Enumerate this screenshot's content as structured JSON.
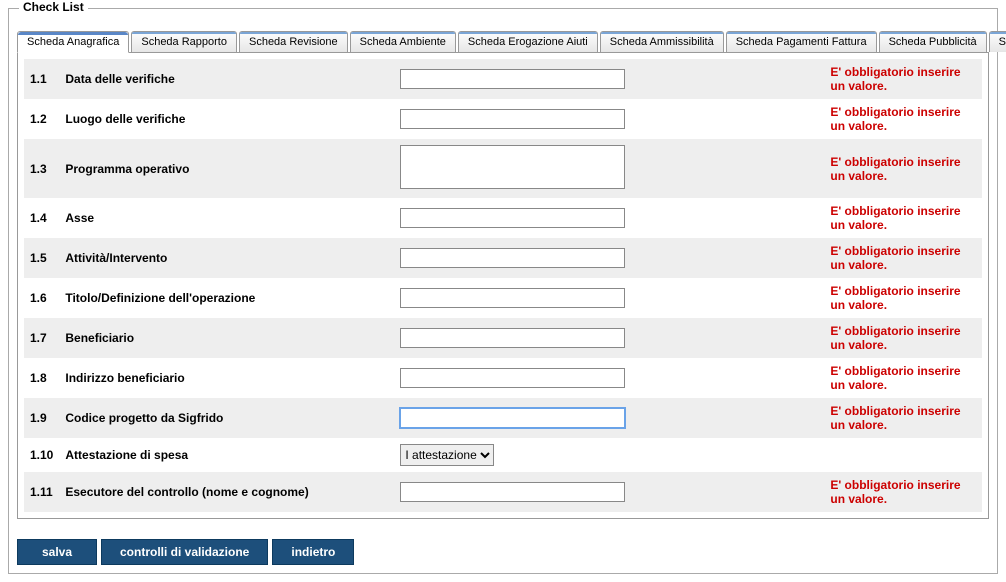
{
  "legend": "Check List",
  "tabs": [
    {
      "label": "Scheda Anagrafica",
      "active": true
    },
    {
      "label": "Scheda Rapporto",
      "active": false
    },
    {
      "label": "Scheda Revisione",
      "active": false
    },
    {
      "label": "Scheda Ambiente",
      "active": false
    },
    {
      "label": "Scheda Erogazione Aiuti",
      "active": false
    },
    {
      "label": "Scheda Ammissibilità",
      "active": false
    },
    {
      "label": "Scheda Pagamenti Fattura",
      "active": false
    },
    {
      "label": "Scheda Pubblicità",
      "active": false
    },
    {
      "label": "Scheda Generale",
      "active": false
    }
  ],
  "rows": [
    {
      "num": "1.1",
      "label": "Data delle verifiche",
      "type": "text",
      "value": "",
      "error": "E' obbligatorio inserire un valore."
    },
    {
      "num": "1.2",
      "label": "Luogo delle verifiche",
      "type": "text",
      "value": "",
      "error": "E' obbligatorio inserire un valore."
    },
    {
      "num": "1.3",
      "label": "Programma operativo",
      "type": "listbox",
      "value": "",
      "error": "E' obbligatorio inserire un valore."
    },
    {
      "num": "1.4",
      "label": "Asse",
      "type": "text",
      "value": "",
      "error": "E' obbligatorio inserire un valore."
    },
    {
      "num": "1.5",
      "label": "Attività/Intervento",
      "type": "text",
      "value": "",
      "error": "E' obbligatorio inserire un valore."
    },
    {
      "num": "1.6",
      "label": "Titolo/Definizione dell'operazione",
      "type": "text",
      "value": "",
      "error": "E' obbligatorio inserire un valore."
    },
    {
      "num": "1.7",
      "label": "Beneficiario",
      "type": "text",
      "value": "",
      "error": "E' obbligatorio inserire un valore."
    },
    {
      "num": "1.8",
      "label": "Indirizzo beneficiario",
      "type": "text",
      "value": "",
      "error": "E' obbligatorio inserire un valore."
    },
    {
      "num": "1.9",
      "label": "Codice progetto da Sigfrido",
      "type": "text",
      "value": "",
      "error": "E' obbligatorio inserire un valore.",
      "focused": true
    },
    {
      "num": "1.10",
      "label": "Attestazione di spesa",
      "type": "select",
      "value": "I attestazione",
      "options": [
        "I attestazione"
      ],
      "error": ""
    },
    {
      "num": "1.11",
      "label": "Esecutore del controllo (nome e cognome)",
      "type": "text",
      "value": "",
      "error": "E' obbligatorio inserire un valore."
    }
  ],
  "buttons": {
    "save": "salva",
    "validate": "controlli di validazione",
    "back": "indietro"
  }
}
